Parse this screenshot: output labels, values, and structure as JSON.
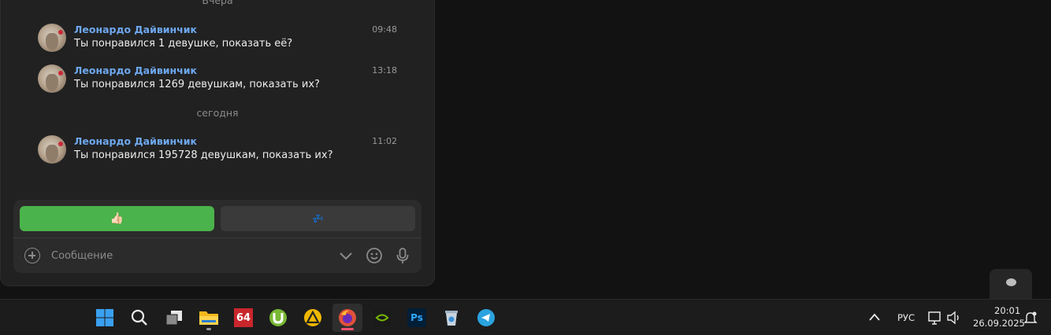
{
  "chat": {
    "date_yesterday": "Вчера",
    "date_today": "сегодня",
    "messages": [
      {
        "author": "Леонардо Дайвинчик",
        "time": "09:48",
        "text": "Ты понравился 1 девушке, показать её?"
      },
      {
        "author": "Леонардо Дайвинчик",
        "time": "13:18",
        "text": "Ты понравился 1269 девушкам, показать их?"
      },
      {
        "author": "Леонардо Дайвинчик",
        "time": "11:02",
        "text": "Ты понравился 195728 девушкам, показать их?"
      }
    ]
  },
  "reply_buttons": {
    "like": "👍🏻",
    "sleep": "💤"
  },
  "composer": {
    "placeholder": "Сообщение"
  },
  "taskbar": {
    "apps": [
      "windows-start",
      "search",
      "task-view",
      "file-explorer",
      "aida64",
      "utorrent",
      "alist",
      "firefox",
      "nvidia",
      "photoshop",
      "recycle-bin",
      "telegram"
    ],
    "aida64_label": "64",
    "photoshop_label": "Ps",
    "language": "РУС",
    "time": "20:01",
    "date": "26.09.2025"
  },
  "colors": {
    "accent_green": "#4bb34b",
    "author_blue": "#6ea8ef",
    "firefox_indicator": "#f0506e"
  }
}
